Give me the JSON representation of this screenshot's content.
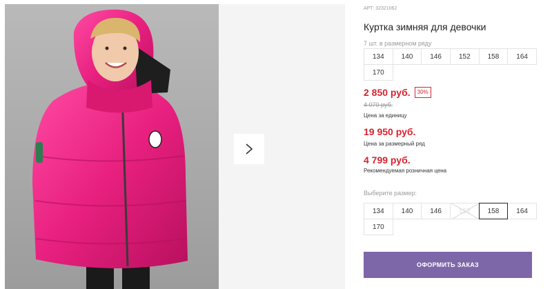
{
  "product": {
    "art_label": "АРТ:",
    "art_number": "32321062",
    "title": "Куртка зимняя для девочки",
    "pack_label": "7 шт. в размерном ряду",
    "pack_sizes": [
      "134",
      "140",
      "146",
      "152",
      "158",
      "164",
      "170"
    ]
  },
  "pricing": {
    "unit_price": "2 850 руб.",
    "discount": "30%",
    "old_price": "4 070 руб.",
    "unit_label": "Цена за единицу",
    "pack_price": "19 950 руб.",
    "pack_label": "Цена за размерный ряд",
    "rrp": "4 799 руб.",
    "rrp_label": "Рекомендуемая розничная цена"
  },
  "size_select": {
    "label": "Выберите размер:",
    "options": [
      "134",
      "140",
      "146",
      "152",
      "158",
      "164",
      "170"
    ],
    "selected": "158",
    "unavailable": "152"
  },
  "order_button": {
    "label": "ОФОРМИТЬ ЗАКАЗ"
  },
  "gallery": {
    "next_icon": "chevron-right-icon"
  },
  "colors": {
    "accent_price": "#d7232f",
    "button": "#7d67a8",
    "jacket": "#e8207f"
  }
}
